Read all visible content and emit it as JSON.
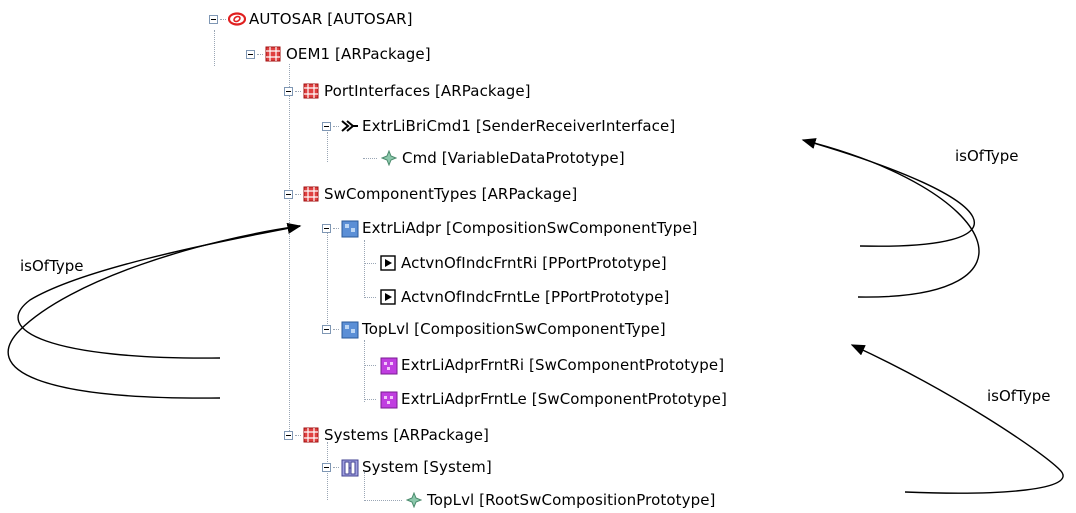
{
  "tree": [
    {
      "label": "AUTOSAR [AUTOSAR]",
      "icon": "autosar-logo-icon"
    },
    {
      "label": "OEM1 [ARPackage]",
      "icon": "package-icon"
    },
    {
      "label": "PortInterfaces [ARPackage]",
      "icon": "package-icon"
    },
    {
      "label": "ExtrLiBriCmd1 [SenderReceiverInterface]",
      "icon": "sender-receiver-interface-icon"
    },
    {
      "label": "Cmd [VariableDataPrototype]",
      "icon": "data-prototype-icon"
    },
    {
      "label": "SwComponentTypes [ARPackage]",
      "icon": "package-icon"
    },
    {
      "label": "ExtrLiAdpr [CompositionSwComponentType]",
      "icon": "composition-icon"
    },
    {
      "label": "ActvnOfIndcFrntRi [PPortPrototype]",
      "icon": "pport-icon"
    },
    {
      "label": "ActvnOfIndcFrntLe [PPortPrototype]",
      "icon": "pport-icon"
    },
    {
      "label": "TopLvl [CompositionSwComponentType]",
      "icon": "composition-icon"
    },
    {
      "label": "ExtrLiAdprFrntRi [SwComponentPrototype]",
      "icon": "component-prototype-icon"
    },
    {
      "label": "ExtrLiAdprFrntLe [SwComponentPrototype]",
      "icon": "component-prototype-icon"
    },
    {
      "label": "Systems [ARPackage]",
      "icon": "package-icon"
    },
    {
      "label": "System [System]",
      "icon": "system-icon"
    },
    {
      "label": "TopLvl [RootSwCompositionPrototype]",
      "icon": "data-prototype-icon"
    }
  ],
  "annotations": {
    "left": "isOfType",
    "top_right": "isOfType",
    "bottom_right": "isOfType"
  },
  "colors": {
    "package": "#cc2222",
    "autosar_logo": "#e02020",
    "composition": "#5b8fd6",
    "component_prototype": "#c03ee0",
    "system": "#8080c8",
    "data_prototype": "#6aa88c",
    "tree_line": "#9aa6b5"
  }
}
